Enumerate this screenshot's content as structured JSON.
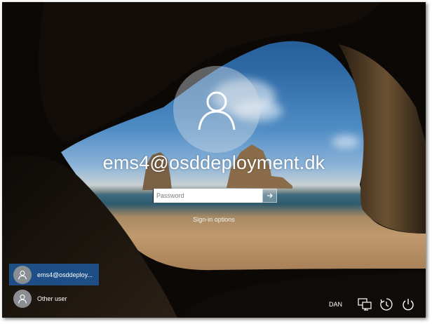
{
  "login": {
    "username": "ems4@osddeployment.dk",
    "password_placeholder": "Password",
    "sign_in_options": "Sign-in options"
  },
  "users": [
    {
      "label": "ems4@osddeploy...",
      "selected": true
    },
    {
      "label": "Other user",
      "selected": false
    }
  ],
  "tray": {
    "language": "DAN",
    "icons": [
      "network-icon",
      "ease-of-access-icon",
      "power-icon"
    ]
  },
  "colors": {
    "selected_tile": "#1d4f86",
    "avatar_circle": "#d7dee4"
  }
}
